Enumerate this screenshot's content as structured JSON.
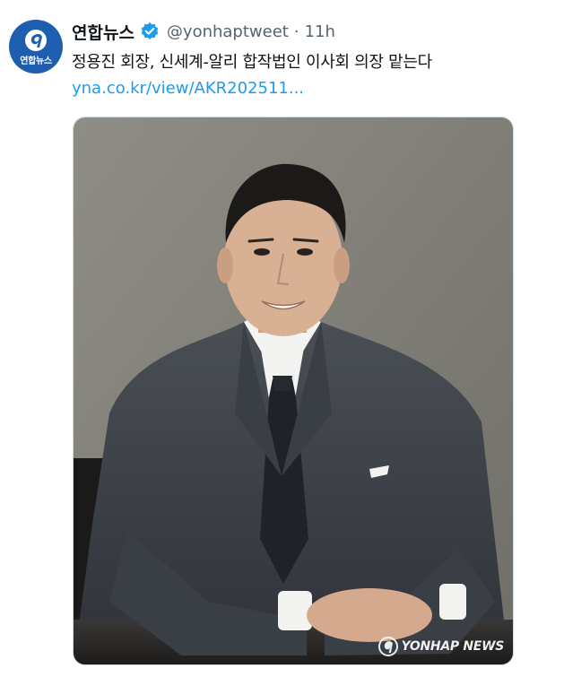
{
  "tweet": {
    "avatar": {
      "label": "연합뉴스",
      "color": "#1d5fae"
    },
    "display_name": "연합뉴스",
    "verified_badge_color": "#1d9bf0",
    "handle": "@yonhaptweet",
    "separator": "·",
    "time": "11h",
    "text": "정용진 회장, 신세계-알리 합작법인 이사회 의장 맡는다",
    "link": "yna.co.kr/view/AKR202511...",
    "link_color": "#1d9bf0",
    "media": {
      "watermark": "YONHAP NEWS"
    }
  }
}
